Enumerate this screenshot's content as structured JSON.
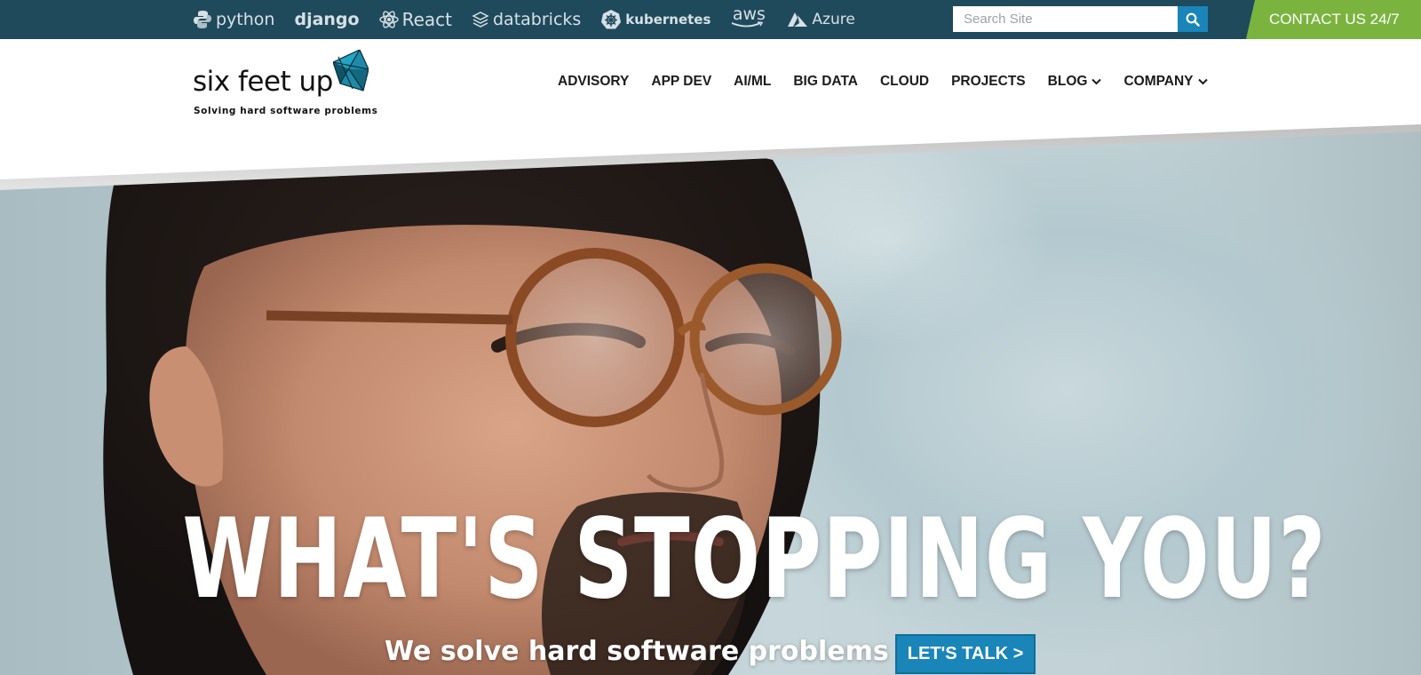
{
  "topbar": {
    "tech_logos": [
      {
        "name": "python",
        "label": "python"
      },
      {
        "name": "django",
        "label": "django"
      },
      {
        "name": "react",
        "label": "React"
      },
      {
        "name": "databricks",
        "label": "databricks"
      },
      {
        "name": "kubernetes",
        "label": "kubernetes"
      },
      {
        "name": "aws",
        "label": "aws"
      },
      {
        "name": "azure",
        "label": "Azure"
      }
    ],
    "search": {
      "placeholder": "Search Site",
      "value": ""
    },
    "contact_label": "CONTACT US 24/7"
  },
  "header": {
    "logo_text": "six feet up",
    "logo_tagline": "Solving hard software problems",
    "nav": [
      {
        "label": "ADVISORY",
        "has_dropdown": false
      },
      {
        "label": "APP DEV",
        "has_dropdown": false
      },
      {
        "label": "AI/ML",
        "has_dropdown": false
      },
      {
        "label": "BIG DATA",
        "has_dropdown": false
      },
      {
        "label": "CLOUD",
        "has_dropdown": false
      },
      {
        "label": "PROJECTS",
        "has_dropdown": false
      },
      {
        "label": "BLOG",
        "has_dropdown": true
      },
      {
        "label": "COMPANY",
        "has_dropdown": true
      }
    ]
  },
  "hero": {
    "headline": "WHAT'S STOPPING YOU?",
    "subline": "We solve hard software problems",
    "cta_label": "LET'S TALK >"
  },
  "colors": {
    "topbar_bg": "#1f4a5c",
    "accent_blue": "#1a85b8",
    "contact_green": "#7ab43f"
  }
}
